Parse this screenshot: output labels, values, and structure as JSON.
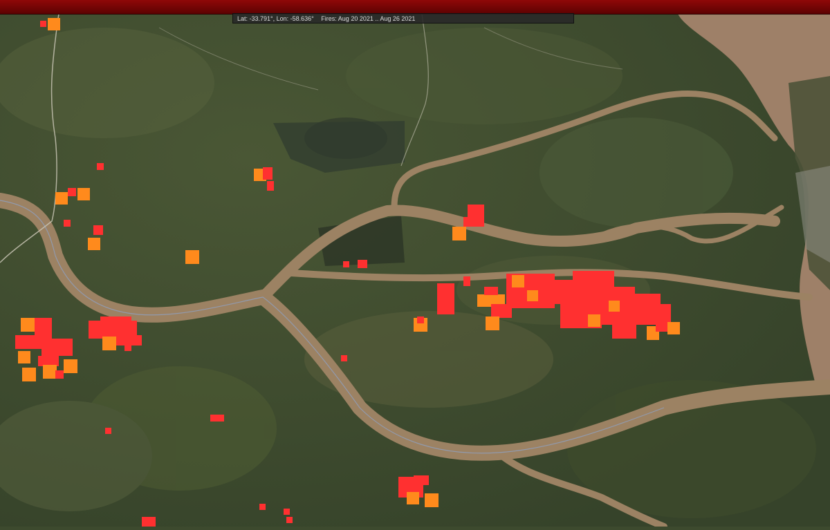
{
  "status_bar": {
    "coordinates": "Lat: -33.791°, Lon: -58.636°",
    "fires_range": "Fires: Aug 20 2021 .. Aug 26 2021"
  },
  "legend_colors": {
    "fire_recent": "#ff3030",
    "fire_older": "#ff8a1c",
    "river": "#9c8263",
    "river_light": "#b59877",
    "land": "#3d4a2e"
  },
  "fire_detections": [
    {
      "lat": -33.62,
      "lon": -58.85,
      "age": "recent"
    },
    {
      "lat": -33.62,
      "lon": -58.84,
      "age": "older"
    }
  ]
}
